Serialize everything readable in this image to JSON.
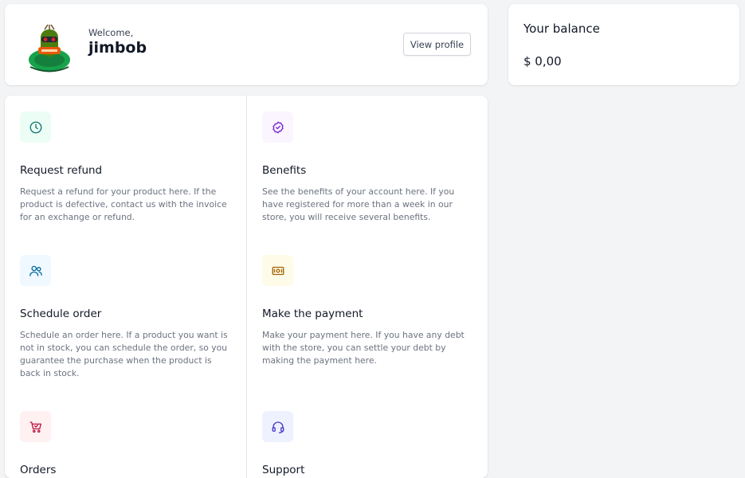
{
  "welcome": {
    "greeting": "Welcome,",
    "username": "jimbob",
    "view_profile_label": "View profile"
  },
  "balance": {
    "title": "Your balance",
    "amount": "$ 0,00"
  },
  "actions": [
    {
      "icon": "clock-icon",
      "title": "Request refund",
      "description": "Request a refund for your product here. If the product is defective, contact us with the invoice for an exchange or refund."
    },
    {
      "icon": "badge-check-icon",
      "title": "Benefits",
      "description": "See the benefits of your account here. If you have registered for more than a week in our store, you will receive several benefits."
    },
    {
      "icon": "users-icon",
      "title": "Schedule order",
      "description": "Schedule an order here. If a product you want is not in stock, you can schedule the order, so you guarantee the purchase when the product is back in stock."
    },
    {
      "icon": "cash-icon",
      "title": "Make the payment",
      "description": "Make your payment here. If you have any debt with the store, you can settle your debt by making the payment here."
    },
    {
      "icon": "cart-icon",
      "title": "Orders",
      "description": ""
    },
    {
      "icon": "headset-icon",
      "title": "Support",
      "description": ""
    }
  ],
  "colors": {
    "teal": "#0f766e",
    "purple": "#7e22ce",
    "sky": "#0369a1",
    "yellow": "#a16207",
    "rose": "#be123c",
    "indigo": "#4338ca"
  }
}
